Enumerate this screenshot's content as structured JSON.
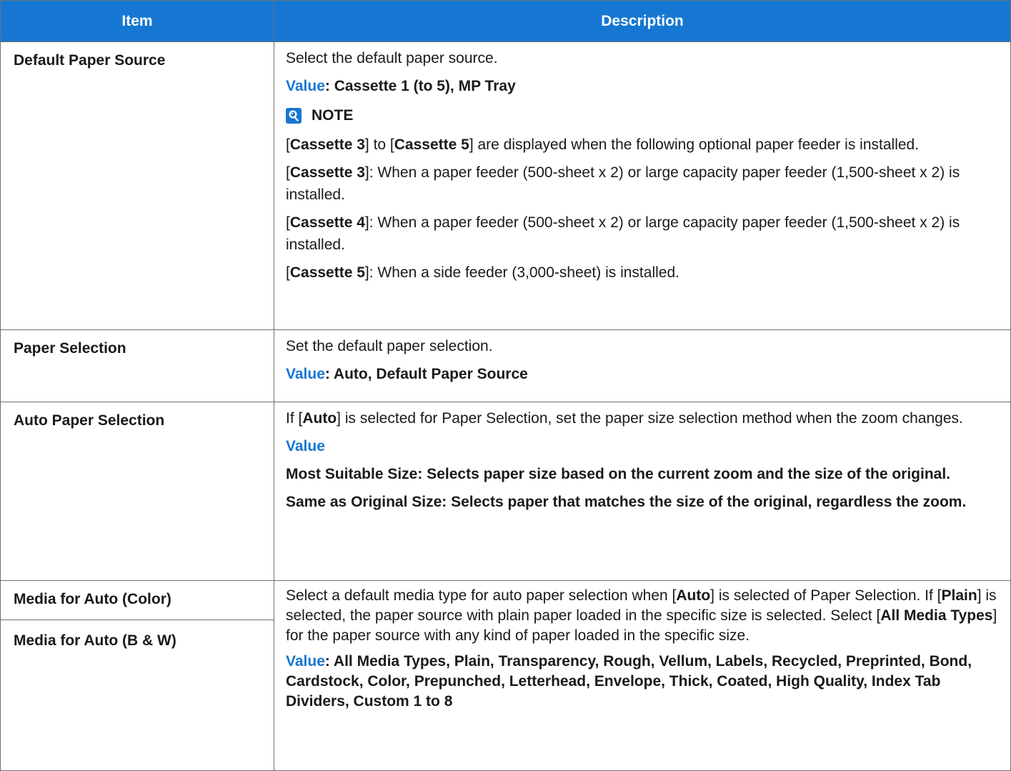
{
  "header": {
    "item": "Item",
    "description": "Description"
  },
  "rows": {
    "default_paper_source": {
      "item": "Default Paper Source",
      "desc": "Select the default paper source.",
      "value_label": "Value",
      "value_text": ": Cassette 1 (to 5), MP Tray",
      "note_label": "NOTE",
      "note1_a": "[",
      "note1_b": "Cassette 3",
      "note1_c": "] to [",
      "note1_d": "Cassette 5",
      "note1_e": "] are displayed when the following optional paper feeder is installed.",
      "note2_b": "Cassette 3",
      "note2_c": "]: When a paper feeder (500-sheet x 2) or large capacity paper feeder (1,500-sheet x 2) is installed.",
      "note3_b": "Cassette 4",
      "note3_c": "]: When a paper feeder (500-sheet x 2) or large capacity paper feeder (1,500-sheet x 2) is installed.",
      "note4_b": "Cassette 5",
      "note4_c": "]: When a side feeder (3,000-sheet) is installed."
    },
    "paper_selection": {
      "item": "Paper Selection",
      "desc": "Set the default paper selection.",
      "value_label": "Value",
      "value_text": ": Auto, Default Paper Source"
    },
    "auto_paper_selection": {
      "item": "Auto Paper Selection",
      "desc_a": "If [",
      "desc_b": "Auto",
      "desc_c": "] is selected for Paper Selection, set the paper size selection method when the zoom changes.",
      "value_label": "Value",
      "opt1": "Most Suitable Size: Selects paper size based on the current zoom and the size of the original.",
      "opt2": "Same as Original Size: Selects paper that matches the size of the original, regardless the zoom."
    },
    "media_for_auto": {
      "item_color": "Media for Auto (Color)",
      "item_bw": "Media for Auto (B & W)",
      "d1": "Select a default media type for auto paper selection when [",
      "d2": "Auto",
      "d3": "] is selected of Paper Selection. If [",
      "d4": "Plain",
      "d5": "] is selected, the paper source with plain paper loaded in the specific size is selected. Select [",
      "d6": "All Media Types",
      "d7": "] for the paper source with any kind of paper loaded in the specific size.",
      "value_label": "Value",
      "value_text": ": All Media Types, Plain, Transparency, Rough, Vellum, Labels, Recycled, Preprinted, Bond, Cardstock, Color, Prepunched, Letterhead, Envelope, Thick, Coated, High Quality, Index Tab Dividers, Custom 1 to 8"
    }
  },
  "icons": {
    "note": "note-lightbulb-icon"
  },
  "colors": {
    "header_bg": "#1677d2",
    "value_label": "#1677d2",
    "border": "#6f6f6f"
  }
}
